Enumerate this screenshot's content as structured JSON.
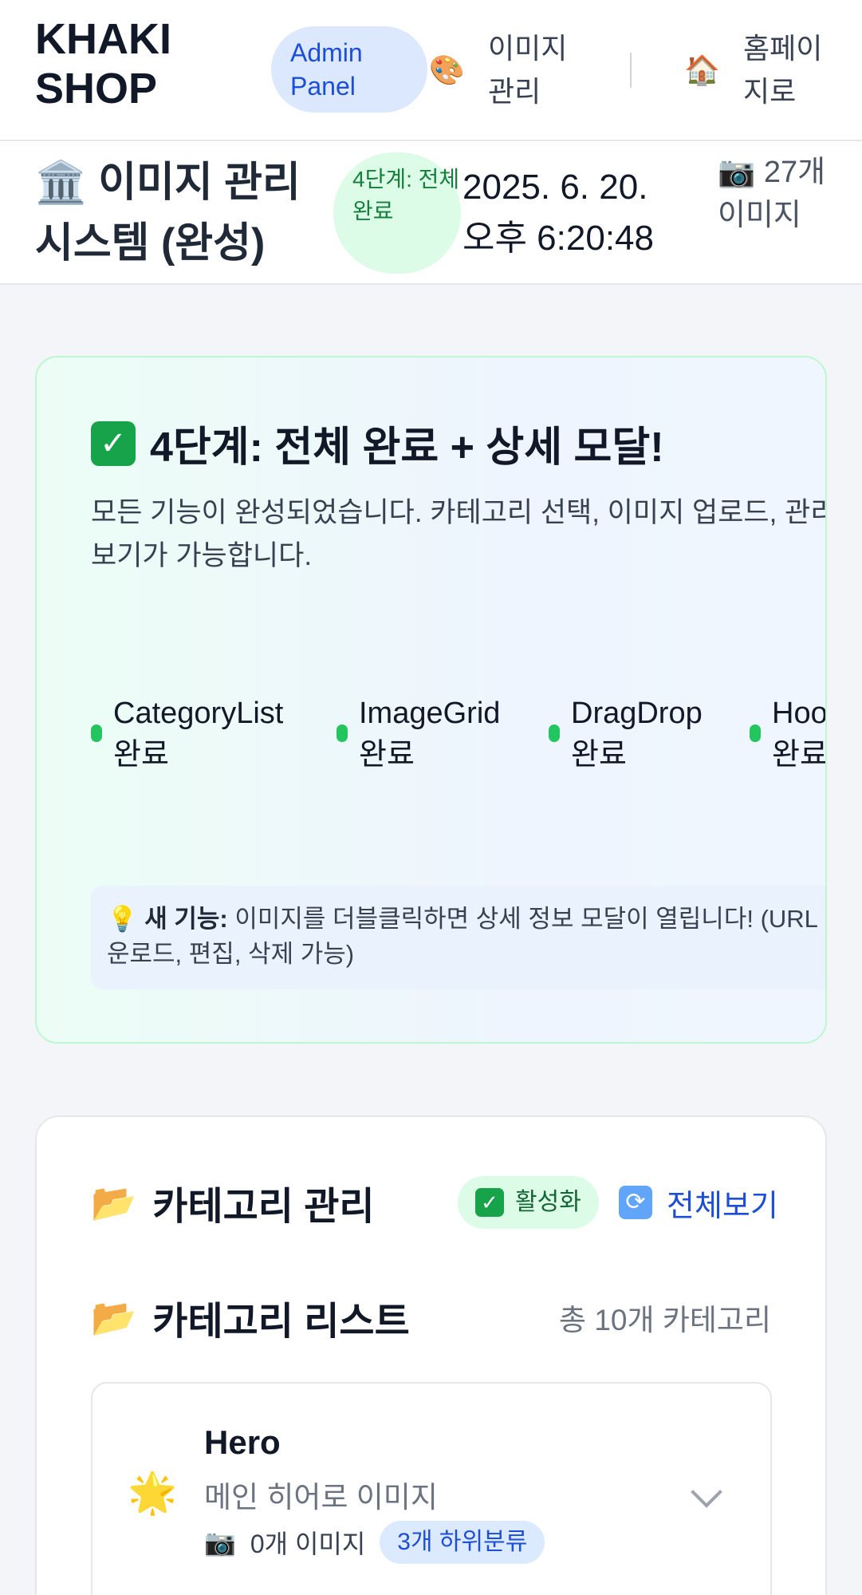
{
  "nav": {
    "brand": "KHAKI SHOP",
    "badge": "Admin Panel",
    "links": [
      {
        "icon": "palette-icon",
        "glyph": "🎨",
        "label": "이미지 관리"
      },
      {
        "icon": "house-icon",
        "glyph": "🏠",
        "label": "홈페이지로"
      }
    ]
  },
  "subheader": {
    "title": "🏛️ 이미지 관리 시스템 (완성)",
    "step_badge": "4단계: 전체 완료",
    "datetime": "2025. 6. 20. 오후 6:20:48",
    "image_count": "📷 27개 이미지"
  },
  "status": {
    "heading": "4단계: 전체 완료 + 상세 모달!",
    "description": "모든 기능이 완성되었습니다. 카테고리 선택, 이미지 업로드, 관리, 상세 보기가 가능합니다.",
    "modules": [
      {
        "name": "CategoryList",
        "state": "완료"
      },
      {
        "name": "ImageGrid",
        "state": "완료"
      },
      {
        "name": "DragDrop",
        "state": "완료"
      },
      {
        "name": "Hook",
        "state": "완료"
      }
    ],
    "tip_label": "새 기능:",
    "tip_line1": "이미지를 더블클릭하면 상세 정보 모달이 열립니다! (URL 복사,",
    "tip_line2": "운로드, 편집, 삭제 가능)"
  },
  "categories": {
    "heading": "카테고리 관리",
    "active_label": "활성화",
    "view_all_label": "전체보기",
    "list_heading": "카테고리 리스트",
    "total": "총 10개 카테고리",
    "items": [
      {
        "icon": "star-icon",
        "name": "Hero",
        "description": "메인 히어로 이미지",
        "images": "0개 이미지",
        "subcategories": "3개 하위분류"
      }
    ]
  }
}
